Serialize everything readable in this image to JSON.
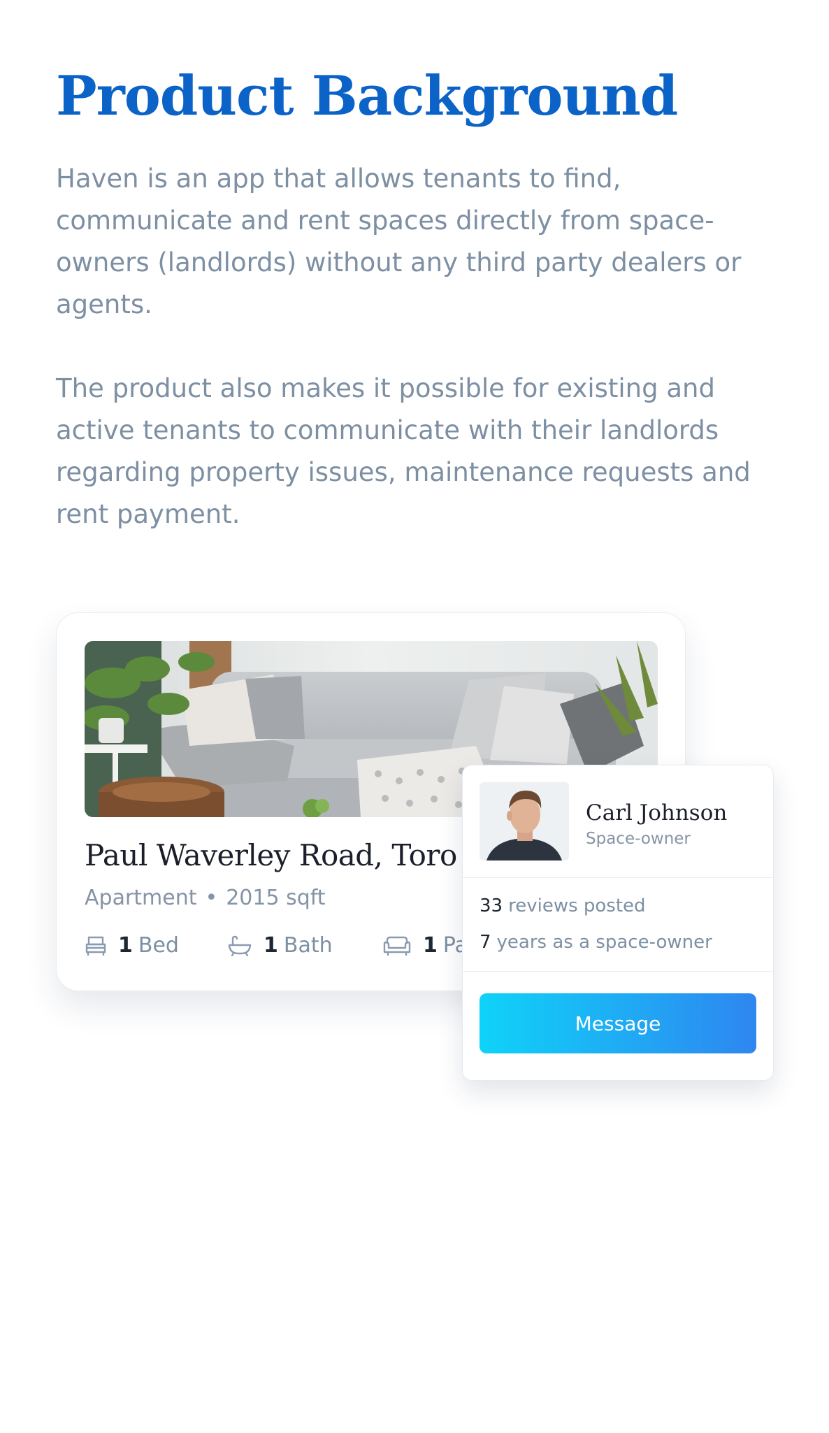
{
  "header": {
    "title": "Product Background"
  },
  "intro": {
    "paragraph_1": "Haven is an app that allows tenants to find, communicate and rent spaces directly from space-owners (landlords) without any third party dealers or agents.",
    "paragraph_2": "The product also makes it possible for existing and active tenants to communicate with their landlords regarding property issues, maintenance requests and rent payment."
  },
  "property": {
    "title": "Paul Waverley Road, Toro",
    "type": "Apartment",
    "separator": "•",
    "size": "2015 sqft",
    "amenities": {
      "bed": {
        "count": "1",
        "label": "Bed",
        "icon": "bed-icon"
      },
      "bath": {
        "count": "1",
        "label": "Bath",
        "icon": "bathtub-icon"
      },
      "parking": {
        "count": "1",
        "label": "Pa",
        "icon": "sofa-icon"
      }
    }
  },
  "owner": {
    "name": "Carl Johnson",
    "role": "Space-owner",
    "reviews": {
      "count": "33",
      "label": "reviews posted"
    },
    "years": {
      "count": "7",
      "label": "years as a space-owner"
    },
    "message_label": "Message"
  },
  "colors": {
    "title": "#0b63c8",
    "body_text": "#7d8fa3",
    "button_gradient_start": "#0fd3f8",
    "button_gradient_end": "#2e86f0"
  }
}
